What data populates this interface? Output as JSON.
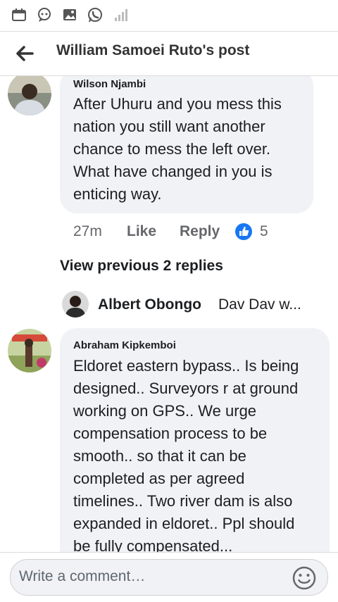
{
  "status_bar": {
    "icons": [
      "calendar-icon",
      "chat-bubble-icon",
      "gallery-icon",
      "whatsapp-icon",
      "signal-icon"
    ]
  },
  "header": {
    "back_icon": "arrow-left-icon",
    "title": "William Samoei Ruto's post"
  },
  "comments": [
    {
      "author": "Wilson Njambi",
      "text_lines": [
        "After Uhuru and you mess this",
        "nation you still want another",
        "chance to mess the left over.",
        "What have changed in you is",
        "enticing way."
      ],
      "time": "27m",
      "like_label": "Like",
      "reply_label": "Reply",
      "reaction_count": "5"
    }
  ],
  "replies": {
    "view_previous": "View previous 2 replies",
    "latest_author": "Albert Obongo",
    "latest_snippet": "Dav Dav w..."
  },
  "comment2": {
    "author": "Abraham Kipkemboi",
    "text_lines": [
      "Eldoret eastern bypass.. Is being",
      "designed.. Surveyors r at ground",
      "working on GPS.. We urge",
      "compensation process to be",
      "smooth.. so that it can be",
      "completed as per agreed",
      "timelines.. Two river dam is also",
      "expanded in eldoret.. Ppl should",
      "be fully compensated..."
    ]
  },
  "composer": {
    "placeholder": "Write a comment…",
    "emoji_icon": "smiley-icon"
  },
  "colors": {
    "bubble": "#f0f2f5",
    "like_blue": "#1877f2",
    "meta_gray": "#65676b"
  }
}
